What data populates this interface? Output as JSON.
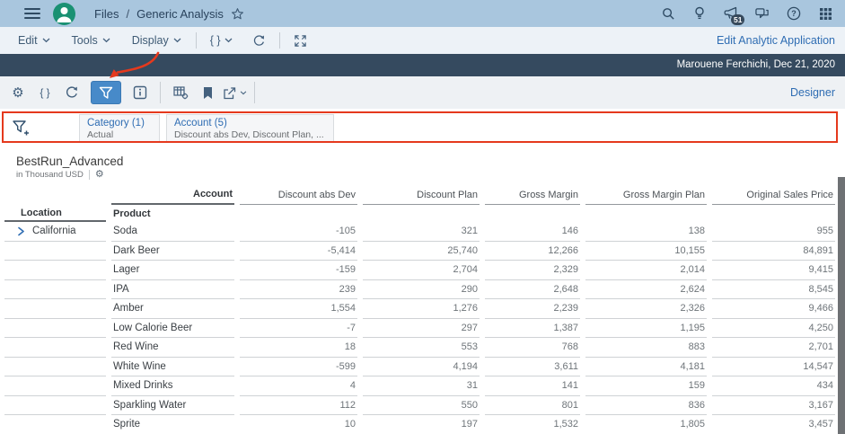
{
  "colors": {
    "accent_red": "#e5391d",
    "link_blue": "#2f6db3",
    "topbar_bg": "#a9c6de",
    "dark_bar_bg": "#354a5f",
    "filter_button_bg": "#478ac9",
    "avatar_green": "#1a9173"
  },
  "topbar": {
    "breadcrumb": {
      "root": "Files",
      "separator": "/",
      "current": "Generic Analysis"
    },
    "right_icons": [
      "search-icon",
      "lightbulb-icon",
      "announcement-icon",
      "chat-icon",
      "help-icon",
      "app-grid-icon"
    ],
    "notification_badge": "51"
  },
  "menubar": {
    "edit_label": "Edit",
    "tools_label": "Tools",
    "display_label": "Display",
    "code_label": "{ }",
    "right_link": "Edit Analytic Application"
  },
  "infobar": {
    "user_and_date": "Marouene Ferchichi, Dec 21, 2020"
  },
  "toolbar": {
    "icons": [
      "settings-icon",
      "code-icon",
      "refresh-icon",
      "filter-icon",
      "info-icon",
      "table-settings-icon",
      "bookmark-icon",
      "export-icon"
    ],
    "right_link": "Designer"
  },
  "filterbar": {
    "tokens": [
      {
        "title": "Category (1)",
        "subtitle": "Actual"
      },
      {
        "title": "Account (5)",
        "subtitle": "Discount abs Dev, Discount Plan, ..."
      }
    ]
  },
  "table": {
    "title": "BestRun_Advanced",
    "unit": "in Thousand USD",
    "column_dimension": "Account",
    "row_dimension_1": "Location",
    "row_dimension_2": "Product",
    "location_value": "California",
    "measures": [
      "Discount abs Dev",
      "Discount Plan",
      "Gross Margin",
      "Gross Margin Plan",
      "Original Sales Price"
    ],
    "rows": [
      {
        "product": "Soda",
        "values": [
          "-105",
          "321",
          "146",
          "138",
          "955"
        ]
      },
      {
        "product": "Dark Beer",
        "values": [
          "-5,414",
          "25,740",
          "12,266",
          "10,155",
          "84,891"
        ]
      },
      {
        "product": "Lager",
        "values": [
          "-159",
          "2,704",
          "2,329",
          "2,014",
          "9,415"
        ]
      },
      {
        "product": "IPA",
        "values": [
          "239",
          "290",
          "2,648",
          "2,624",
          "8,545"
        ]
      },
      {
        "product": "Amber",
        "values": [
          "1,554",
          "1,276",
          "2,239",
          "2,326",
          "9,466"
        ]
      },
      {
        "product": "Low Calorie Beer",
        "values": [
          "-7",
          "297",
          "1,387",
          "1,195",
          "4,250"
        ]
      },
      {
        "product": "Red Wine",
        "values": [
          "18",
          "553",
          "768",
          "883",
          "2,701"
        ]
      },
      {
        "product": "White Wine",
        "values": [
          "-599",
          "4,194",
          "3,611",
          "4,181",
          "14,547"
        ]
      },
      {
        "product": "Mixed Drinks",
        "values": [
          "4",
          "31",
          "141",
          "159",
          "434"
        ]
      },
      {
        "product": "Sparkling Water",
        "values": [
          "112",
          "550",
          "801",
          "836",
          "3,167"
        ]
      },
      {
        "product": "Sprite",
        "values": [
          "10",
          "197",
          "1,532",
          "1,805",
          "3,457"
        ]
      }
    ]
  }
}
